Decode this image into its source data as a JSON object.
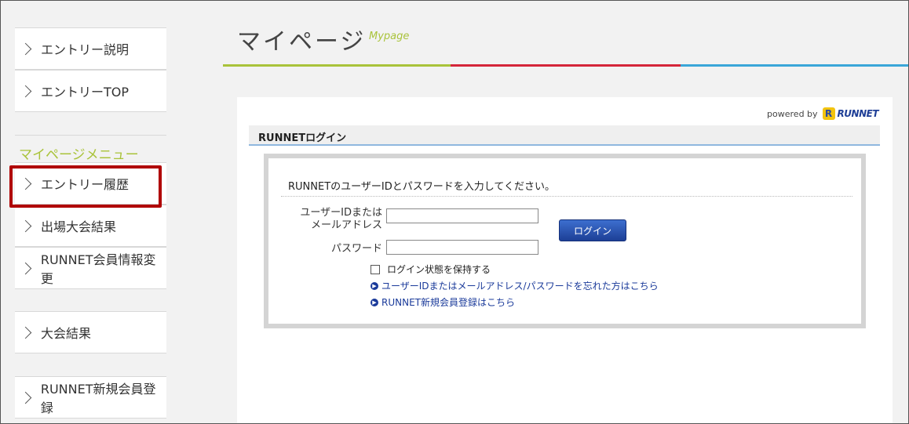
{
  "sidebar": {
    "items": [
      {
        "label": "エントリー説明"
      },
      {
        "label": "エントリーTOP"
      },
      {
        "label": "エントリー履歴"
      },
      {
        "label": "出場大会結果"
      },
      {
        "label": "RUNNET会員情報変更"
      },
      {
        "label": "大会結果"
      },
      {
        "label": "RUNNET新規会員登録"
      }
    ],
    "group_title": "マイページメニュー"
  },
  "header": {
    "title": "マイページ",
    "subtitle": "Mypage"
  },
  "colors": {
    "accent_green": "#a9c33a",
    "accent_red": "#d4263a",
    "accent_blue": "#3aa6d8",
    "highlight": "#b00000"
  },
  "powered": {
    "label": "powered by",
    "logo_text": "RUNNET"
  },
  "login": {
    "section_title": "RUNNETログイン",
    "intro": "RUNNETのユーザーIDとパスワードを入力してください。",
    "user_label_line1": "ユーザーIDまたは",
    "user_label_line2": "メールアドレス",
    "user_value": "",
    "password_label": "パスワード",
    "password_value": "",
    "login_button": "ログイン",
    "remember_label": "ログイン状態を保持する",
    "forgot_link": "ユーザーIDまたはメールアドレス/パスワードを忘れた方はこちら",
    "register_link": "RUNNET新規会員登録はこちら"
  }
}
